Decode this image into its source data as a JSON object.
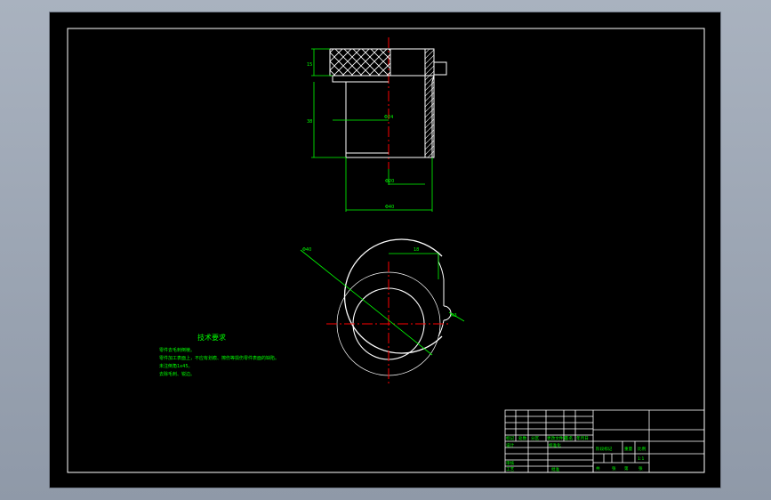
{
  "viewport": {
    "background": "#9aa3b0",
    "sheet_color": "#000000"
  },
  "colors": {
    "outline": "#ffffff",
    "dimension": "#00ff00",
    "centerline": "#ff0000",
    "hatch": "#ffffff"
  },
  "front_view": {
    "dim_top": "15",
    "dim_left": "38",
    "dim_inner": "Φ24",
    "dim_bore": "Φ20",
    "dim_outer": "Φ40"
  },
  "top_view": {
    "dim_width": "18",
    "dim_diameter": "Φ40",
    "dim_notch": "R3"
  },
  "tech_notes": {
    "title": "技术要求",
    "lines": [
      "零件去毛刺倒棱。",
      "零件加工表面上，不应有划痕、擦伤等损伤零件表面的缺陷。",
      "未注倒角1x45。",
      "去除毛刺、锐边。"
    ]
  },
  "title_block": {
    "labels": {
      "marker": "标记",
      "count": "处数",
      "zone": "分区",
      "change_doc": "更改文件号",
      "signature": "签名",
      "date": "年月日",
      "design": "设计",
      "standardize": "标准化",
      "stage_mark": "阶段标记",
      "weight": "重量",
      "scale": "比例",
      "scale_value": "1:1",
      "review": "审核",
      "process": "工艺",
      "approve": "批准",
      "sheets_total": "共",
      "sheet_label": "张",
      "sheet_nth": "第"
    }
  }
}
